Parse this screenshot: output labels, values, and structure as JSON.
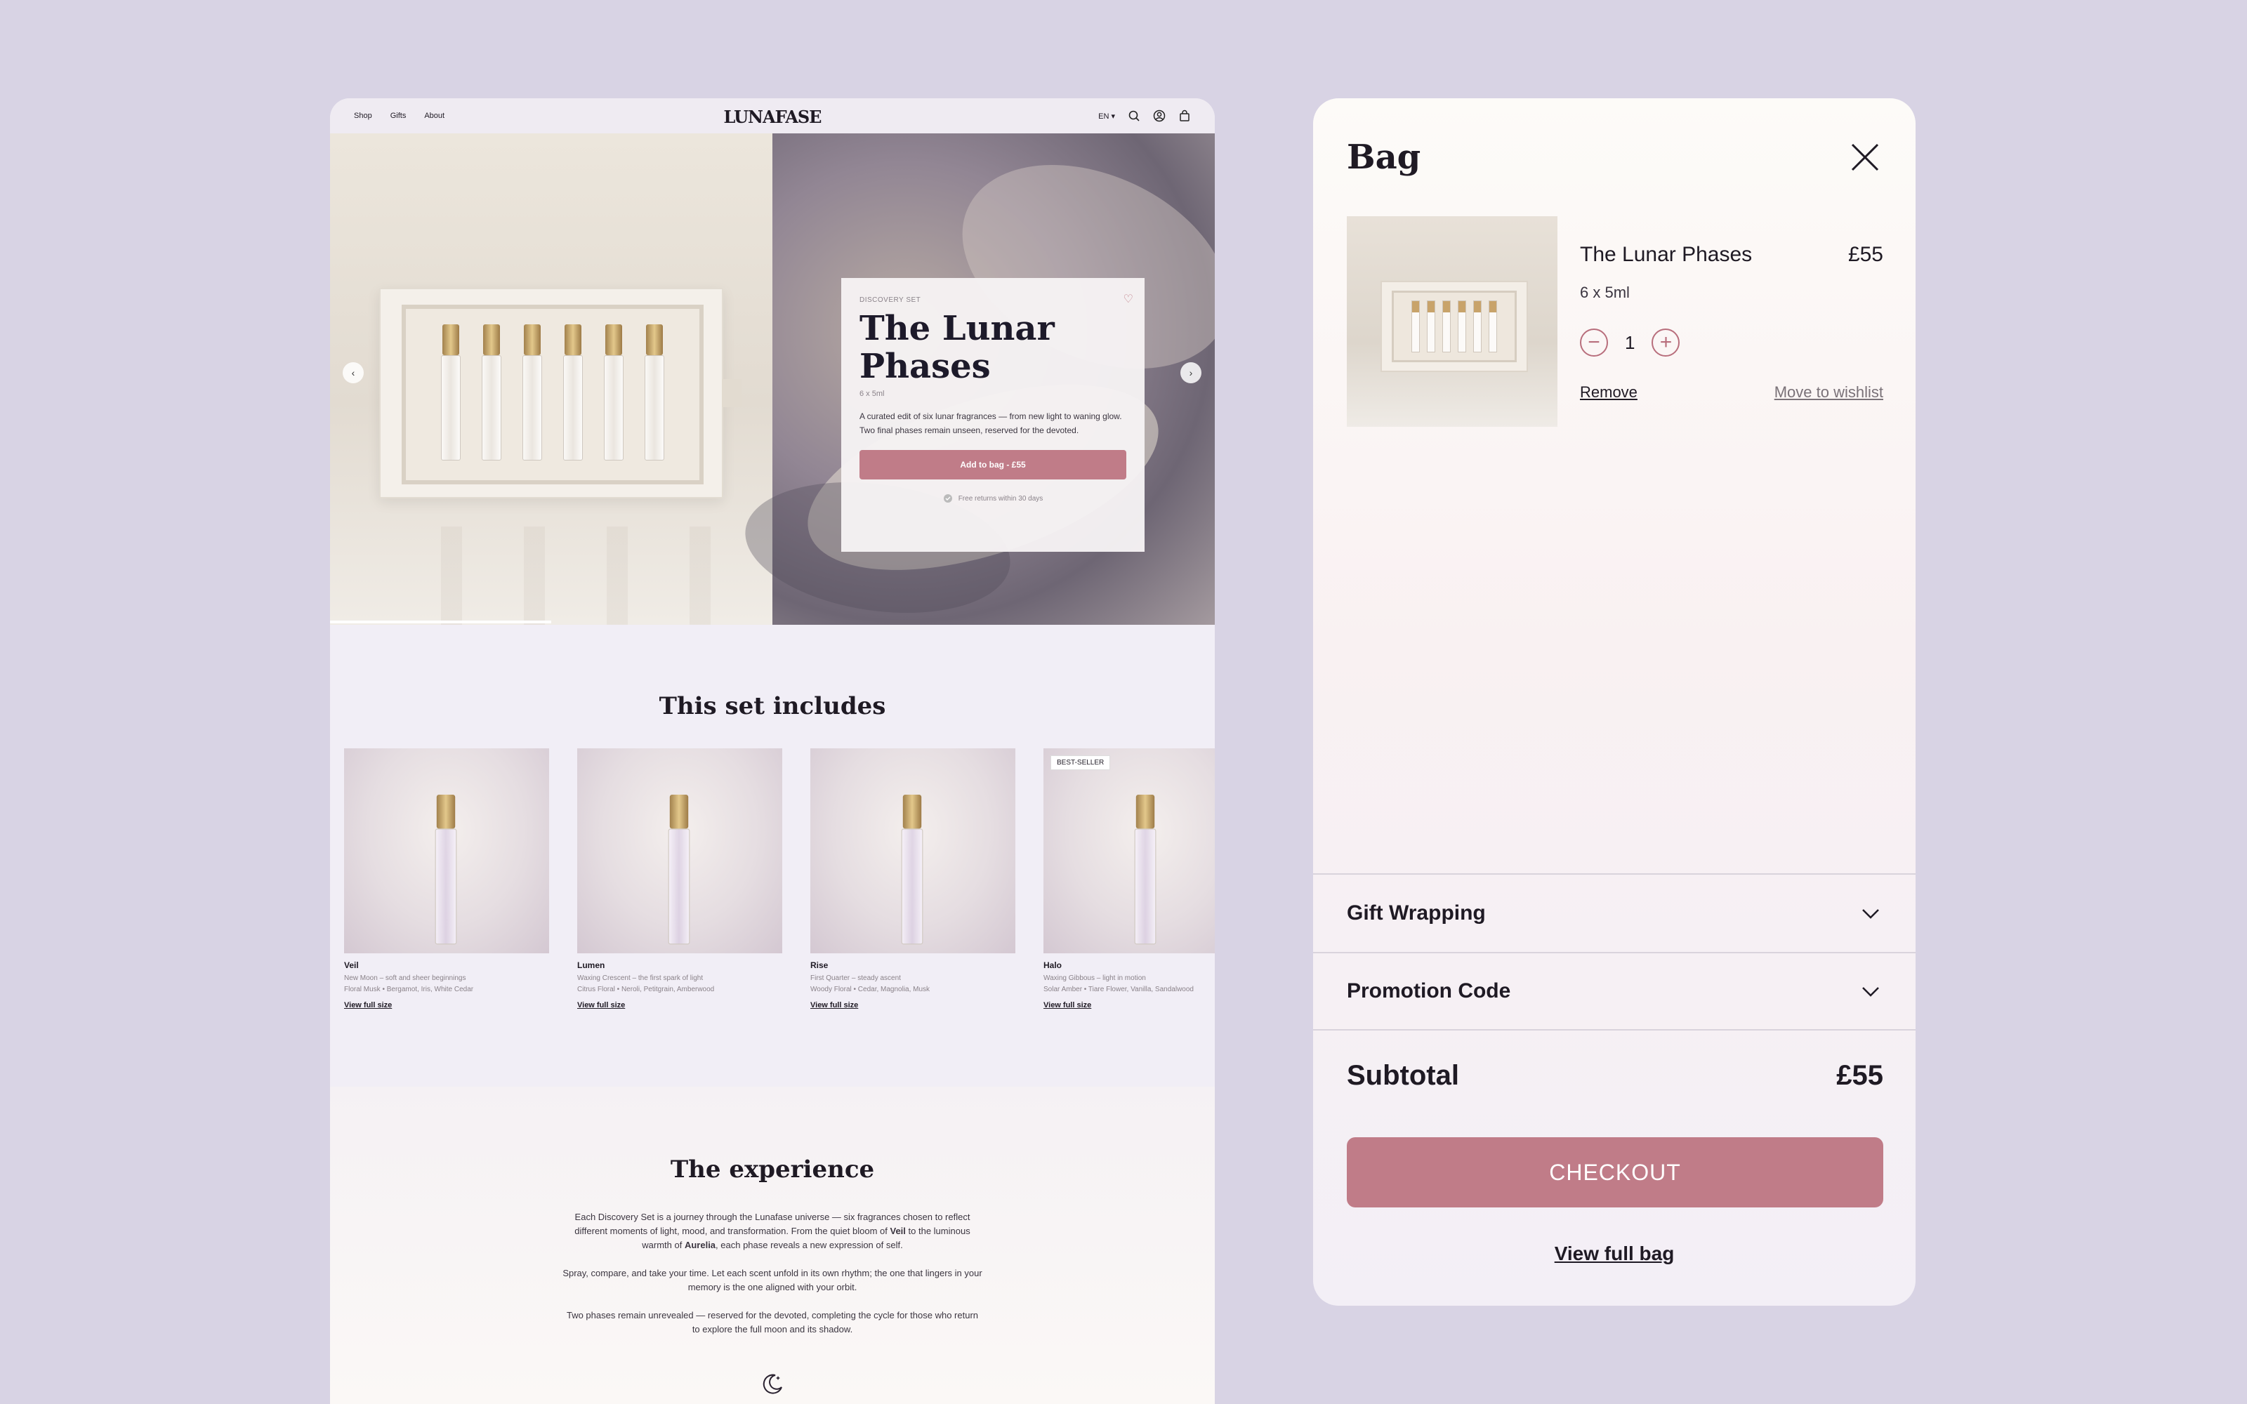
{
  "colors": {
    "background": "#d8d3e4",
    "accent": "#c07c88",
    "text": "#1f1a24"
  },
  "site": {
    "nav": {
      "links": [
        "Shop",
        "Gifts",
        "About"
      ],
      "logo": "LUNAFASE",
      "language": "EN"
    },
    "hero": {
      "eyebrow": "DISCOVERY SET",
      "title": "The Lunar Phases",
      "size": "6 x 5ml",
      "description": "A curated edit of six lunar fragrances — from new light to waning glow. Two final phases remain unseen, reserved for the devoted.",
      "button": "Add to bag - £55",
      "returns": "Free returns within 30 days",
      "slide_progress": 0.25
    },
    "includes": {
      "title": "This set includes",
      "products": [
        {
          "name": "Veil",
          "phase": "New Moon – soft and sheer beginnings",
          "notes": "Floral Musk  •  Bergamot, Iris, White Cedar",
          "link": "View full size",
          "badge": ""
        },
        {
          "name": "Lumen",
          "phase": "Waxing Crescent – the first spark of light",
          "notes": "Citrus Floral  •  Neroli, Petitgrain, Amberwood",
          "link": "View full size",
          "badge": ""
        },
        {
          "name": "Rise",
          "phase": "First Quarter – steady ascent",
          "notes": "Woody Floral  •  Cedar, Magnolia, Musk",
          "link": "View full size",
          "badge": ""
        },
        {
          "name": "Halo",
          "phase": "Waxing Gibbous – light in motion",
          "notes": "Solar Amber  •  Tiare Flower, Vanilla, Sandalwood",
          "link": "View full size",
          "badge": "BEST-SELLER"
        }
      ]
    },
    "experience": {
      "title": "The experience",
      "p1a": "Each Discovery Set is a journey through the Lunafase universe — six fragrances chosen to reflect different moments of light, mood, and transformation. From the quiet bloom of ",
      "p1b": "Veil",
      "p1c": " to the luminous warmth of ",
      "p1d": "Aurelia",
      "p1e": ", each phase reveals a new expression of self.",
      "p2": "Spray, compare, and take your time. Let each scent unfold in its own rhythm; the one that lingers in your memory is the one aligned with your orbit.",
      "p3": "Two phases remain unrevealed — reserved for the devoted, completing the cycle for those who return to explore the full moon and its shadow."
    }
  },
  "bag": {
    "title": "Bag",
    "item": {
      "name": "The Lunar Phases",
      "price": "£55",
      "variant": "6 x 5ml",
      "quantity": "1",
      "remove": "Remove",
      "wishlist": "Move to wishlist"
    },
    "gift_wrapping": "Gift Wrapping",
    "promotion_code": "Promotion Code",
    "subtotal_label": "Subtotal",
    "subtotal_value": "£55",
    "checkout": "CHECKOUT",
    "view_full_bag": "View full bag"
  }
}
